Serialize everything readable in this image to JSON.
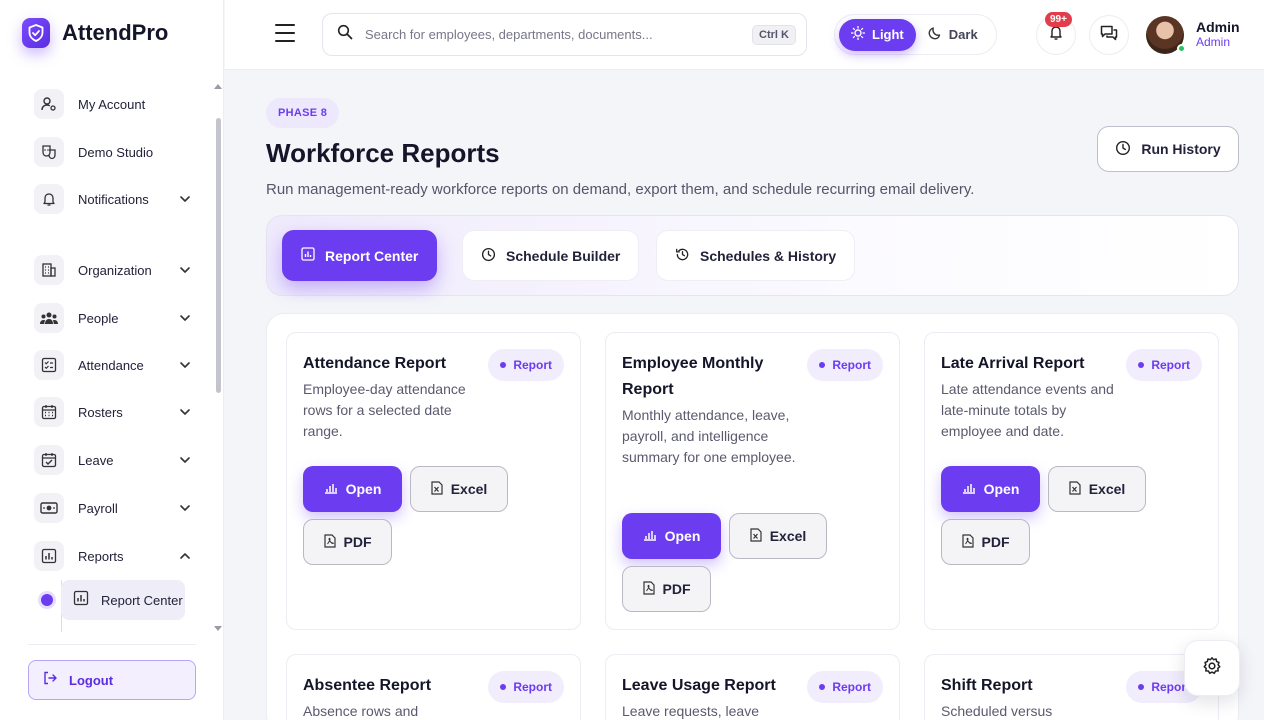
{
  "brand": {
    "name": "AttendPro"
  },
  "sidebar": {
    "items": [
      {
        "label": "My Account",
        "icon": "user-gear-icon"
      },
      {
        "label": "Demo Studio",
        "icon": "masks-icon"
      },
      {
        "label": "Notifications",
        "icon": "bell-icon"
      },
      {
        "label": "Organization",
        "icon": "building-icon"
      },
      {
        "label": "People",
        "icon": "users-icon"
      },
      {
        "label": "Attendance",
        "icon": "checklist-icon"
      },
      {
        "label": "Rosters",
        "icon": "calendar-icon"
      },
      {
        "label": "Leave",
        "icon": "calendar-check-icon"
      },
      {
        "label": "Payroll",
        "icon": "money-icon"
      },
      {
        "label": "Reports",
        "icon": "chart-icon"
      }
    ],
    "sub_item": {
      "label": "Report Center"
    },
    "logout": "Logout"
  },
  "header": {
    "search_placeholder": "Search for employees, departments, documents...",
    "search_shortcut": "Ctrl K",
    "theme_light": "Light",
    "theme_dark": "Dark",
    "notifications_badge": "99+",
    "user": {
      "name": "Admin",
      "role": "Admin"
    }
  },
  "page": {
    "phase": "PHASE 8",
    "title": "Workforce Reports",
    "subtitle": "Run management-ready workforce reports on demand, export them, and schedule recurring email delivery.",
    "run_history": "Run History",
    "tabs": [
      {
        "label": "Report Center",
        "active": true
      },
      {
        "label": "Schedule Builder",
        "active": false
      },
      {
        "label": "Schedules & History",
        "active": false
      }
    ]
  },
  "cards": [
    {
      "title": "Attendance Report",
      "desc": "Employee-day attendance rows for a selected date range.",
      "chip": "Report",
      "open": "Open",
      "excel": "Excel",
      "pdf": "PDF"
    },
    {
      "title": "Employee Monthly Report",
      "desc": "Monthly attendance, leave, payroll, and intelligence summary for one employee.",
      "chip": "Report",
      "open": "Open",
      "excel": "Excel",
      "pdf": "PDF"
    },
    {
      "title": "Late Arrival Report",
      "desc": "Late attendance events and late-minute totals by employee and date.",
      "chip": "Report",
      "open": "Open",
      "excel": "Excel",
      "pdf": "PDF"
    },
    {
      "title": "Absentee Report",
      "desc": "Absence rows and",
      "chip": "Report"
    },
    {
      "title": "Leave Usage Report",
      "desc": "Leave requests, leave",
      "chip": "Report"
    },
    {
      "title": "Shift Report",
      "desc": "Scheduled versus",
      "chip": "Report"
    }
  ],
  "colors": {
    "accent": "#6b3cf0",
    "badge": "#e23d4b",
    "online": "#22c55e"
  }
}
